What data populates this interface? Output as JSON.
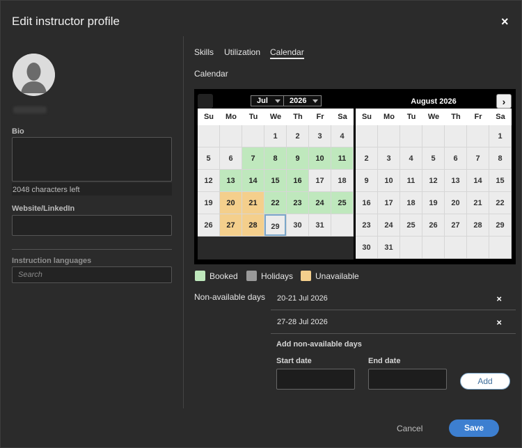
{
  "dialog": {
    "title": "Edit instructor profile",
    "close_icon": "×"
  },
  "profile": {
    "bio_label": "Bio",
    "bio_value": "",
    "chars_left": "2048 characters left",
    "website_label": "Website/LinkedIn",
    "website_value": "",
    "languages_label": "Instruction languages",
    "languages_placeholder": "Search"
  },
  "tabs": [
    {
      "label": "Skills",
      "active": false
    },
    {
      "label": "Utilization",
      "active": false
    },
    {
      "label": "Calendar",
      "active": true
    }
  ],
  "calendar": {
    "title": "Calendar",
    "left_month": {
      "month_select": "Jul",
      "year_select": "2026",
      "dow": [
        "Su",
        "Mo",
        "Tu",
        "We",
        "Th",
        "Fr",
        "Sa"
      ],
      "days": [
        {
          "d": "",
          "s": "empty"
        },
        {
          "d": "",
          "s": "empty"
        },
        {
          "d": "",
          "s": "empty"
        },
        {
          "d": "1",
          "s": ""
        },
        {
          "d": "2",
          "s": ""
        },
        {
          "d": "3",
          "s": ""
        },
        {
          "d": "4",
          "s": ""
        },
        {
          "d": "5",
          "s": ""
        },
        {
          "d": "6",
          "s": ""
        },
        {
          "d": "7",
          "s": "booked"
        },
        {
          "d": "8",
          "s": "booked"
        },
        {
          "d": "9",
          "s": "booked"
        },
        {
          "d": "10",
          "s": "booked"
        },
        {
          "d": "11",
          "s": "booked"
        },
        {
          "d": "12",
          "s": ""
        },
        {
          "d": "13",
          "s": "booked"
        },
        {
          "d": "14",
          "s": "booked"
        },
        {
          "d": "15",
          "s": "booked"
        },
        {
          "d": "16",
          "s": "booked"
        },
        {
          "d": "17",
          "s": ""
        },
        {
          "d": "18",
          "s": ""
        },
        {
          "d": "19",
          "s": ""
        },
        {
          "d": "20",
          "s": "unavail"
        },
        {
          "d": "21",
          "s": "unavail"
        },
        {
          "d": "22",
          "s": "booked"
        },
        {
          "d": "23",
          "s": "booked"
        },
        {
          "d": "24",
          "s": "booked"
        },
        {
          "d": "25",
          "s": "booked"
        },
        {
          "d": "26",
          "s": ""
        },
        {
          "d": "27",
          "s": "unavail"
        },
        {
          "d": "28",
          "s": "unavail"
        },
        {
          "d": "29",
          "s": "today"
        },
        {
          "d": "30",
          "s": ""
        },
        {
          "d": "31",
          "s": ""
        },
        {
          "d": "",
          "s": "empty"
        }
      ]
    },
    "right_month": {
      "title": "August 2026",
      "next_icon": "›",
      "dow": [
        "Su",
        "Mo",
        "Tu",
        "We",
        "Th",
        "Fr",
        "Sa"
      ],
      "days": [
        {
          "d": "",
          "s": "empty"
        },
        {
          "d": "",
          "s": "empty"
        },
        {
          "d": "",
          "s": "empty"
        },
        {
          "d": "",
          "s": "empty"
        },
        {
          "d": "",
          "s": "empty"
        },
        {
          "d": "",
          "s": "empty"
        },
        {
          "d": "1",
          "s": ""
        },
        {
          "d": "2",
          "s": ""
        },
        {
          "d": "3",
          "s": ""
        },
        {
          "d": "4",
          "s": ""
        },
        {
          "d": "5",
          "s": ""
        },
        {
          "d": "6",
          "s": ""
        },
        {
          "d": "7",
          "s": ""
        },
        {
          "d": "8",
          "s": ""
        },
        {
          "d": "9",
          "s": ""
        },
        {
          "d": "10",
          "s": ""
        },
        {
          "d": "11",
          "s": ""
        },
        {
          "d": "12",
          "s": ""
        },
        {
          "d": "13",
          "s": ""
        },
        {
          "d": "14",
          "s": ""
        },
        {
          "d": "15",
          "s": ""
        },
        {
          "d": "16",
          "s": ""
        },
        {
          "d": "17",
          "s": ""
        },
        {
          "d": "18",
          "s": ""
        },
        {
          "d": "19",
          "s": ""
        },
        {
          "d": "20",
          "s": ""
        },
        {
          "d": "21",
          "s": ""
        },
        {
          "d": "22",
          "s": ""
        },
        {
          "d": "23",
          "s": ""
        },
        {
          "d": "24",
          "s": ""
        },
        {
          "d": "25",
          "s": ""
        },
        {
          "d": "26",
          "s": ""
        },
        {
          "d": "27",
          "s": ""
        },
        {
          "d": "28",
          "s": ""
        },
        {
          "d": "29",
          "s": ""
        },
        {
          "d": "30",
          "s": ""
        },
        {
          "d": "31",
          "s": ""
        },
        {
          "d": "",
          "s": "empty"
        },
        {
          "d": "",
          "s": "empty"
        },
        {
          "d": "",
          "s": "empty"
        },
        {
          "d": "",
          "s": "empty"
        },
        {
          "d": "",
          "s": "empty"
        }
      ]
    },
    "legend": [
      {
        "label": "Booked",
        "color": "#bfe8bd"
      },
      {
        "label": "Holidays",
        "color": "#9a9a9a"
      },
      {
        "label": "Unavailable",
        "color": "#f4cf8c"
      }
    ]
  },
  "non_available": {
    "label": "Non-available days",
    "items": [
      "20-21 Jul 2026",
      "27-28 Jul 2026"
    ],
    "remove_icon": "×",
    "add_title": "Add non-available days",
    "start_label": "Start date",
    "end_label": "End date",
    "add_button": "Add"
  },
  "footer": {
    "cancel": "Cancel",
    "save": "Save"
  }
}
